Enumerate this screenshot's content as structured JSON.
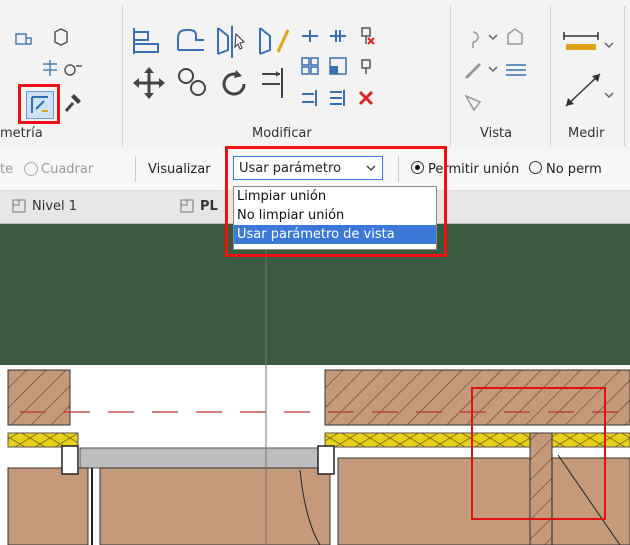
{
  "ribbon": {
    "groups": [
      {
        "label": "metría"
      },
      {
        "label": "Modificar"
      },
      {
        "label": "Vista"
      },
      {
        "label": "Medir"
      }
    ]
  },
  "options_bar": {
    "cut_label": "te",
    "cuadrar_label": "Cuadrar",
    "visualizar_label": "Visualizar",
    "dropdown_value": "Usar parámetro",
    "permitir_label": "Permitir unión",
    "no_permitir_label": "No perm"
  },
  "dropdown": {
    "options": [
      "Limpiar unión",
      "No limpiar unión",
      "Usar parámetro de vista"
    ],
    "selected_index": 2
  },
  "tabs": {
    "nivel": "Nivel 1",
    "plan": "PL"
  },
  "colors": {
    "highlight": "#e11111",
    "canvas_green": "#3a5a3f",
    "wall_brown": "#c49a7a",
    "insulation_yellow": "#e8d11a",
    "selection_blue": "#3b78d8"
  }
}
